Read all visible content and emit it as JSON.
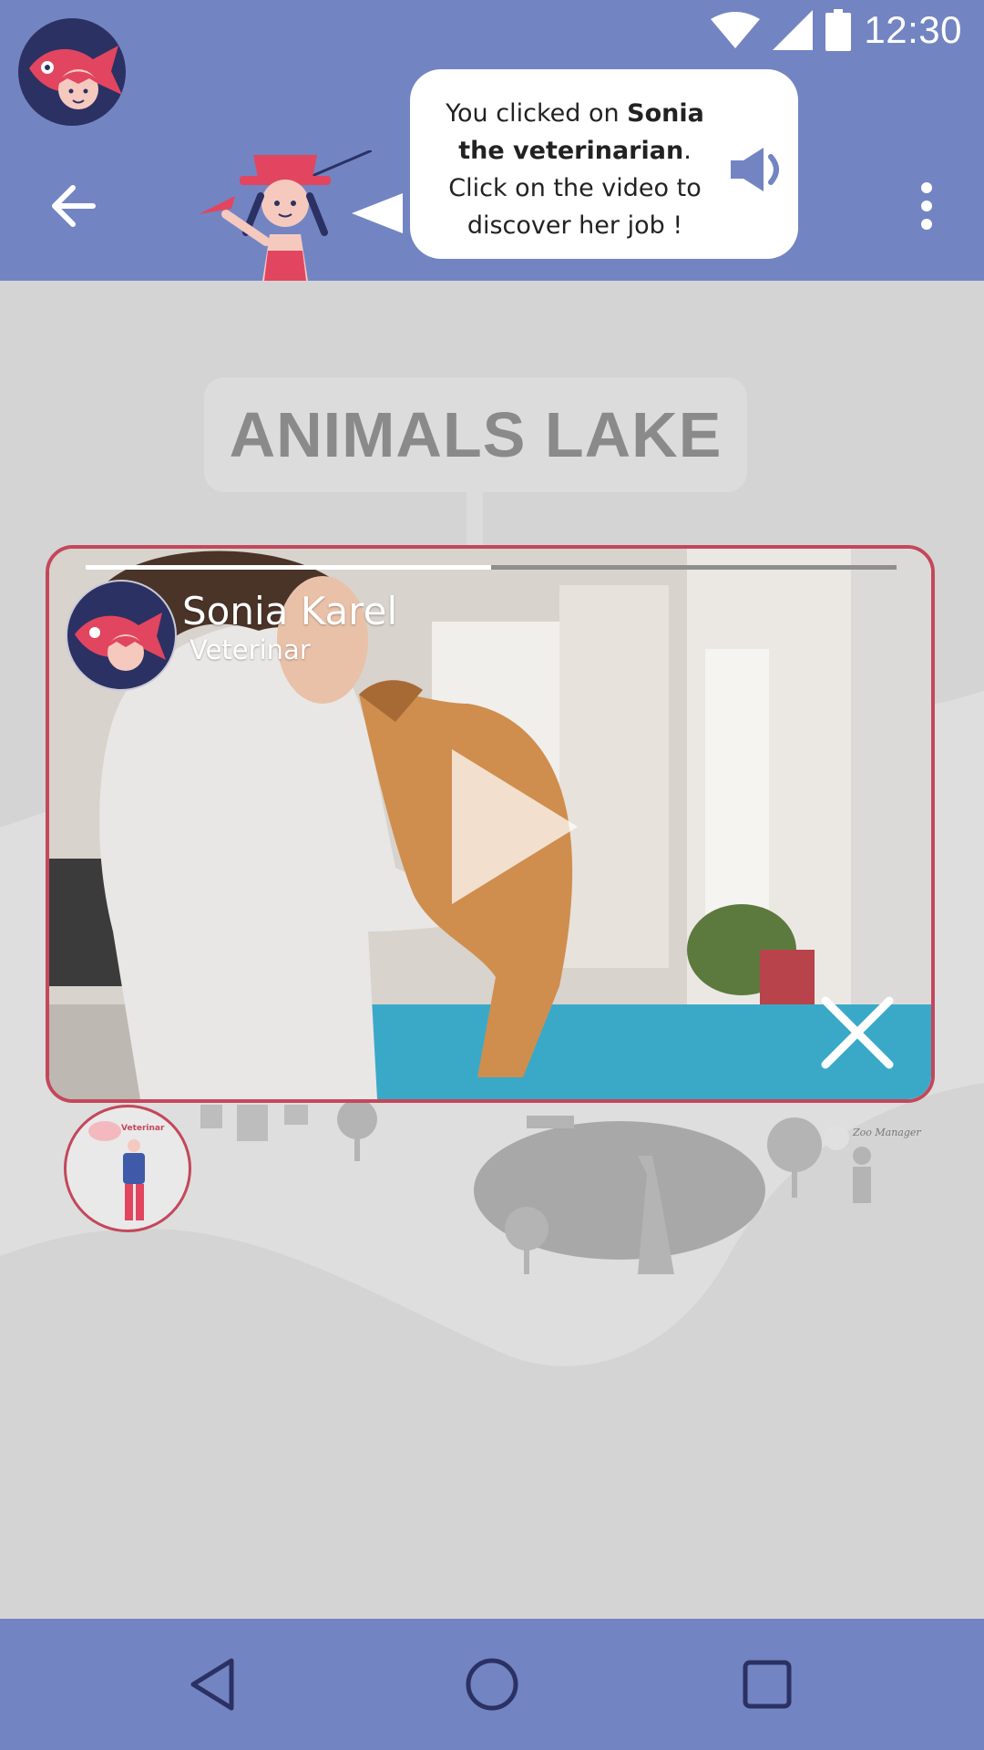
{
  "status_bar": {
    "time": "12:30"
  },
  "header": {
    "bubble": {
      "part1": "You clicked on ",
      "bold1": "Sonia the veterinarian",
      "part2": ". Click on the video to discover her job !"
    }
  },
  "map": {
    "title": "ANIMALS LAKE",
    "marker_label": "Veterinar",
    "zoo_label": "Zoo Manager"
  },
  "video": {
    "name": "Sonia Karel",
    "role": "Veterinar",
    "progress": 0.5
  },
  "colors": {
    "header": "#7384c3",
    "accent": "#c4475b",
    "navy": "#2b3163",
    "map_bg": "#d4d4d4"
  }
}
